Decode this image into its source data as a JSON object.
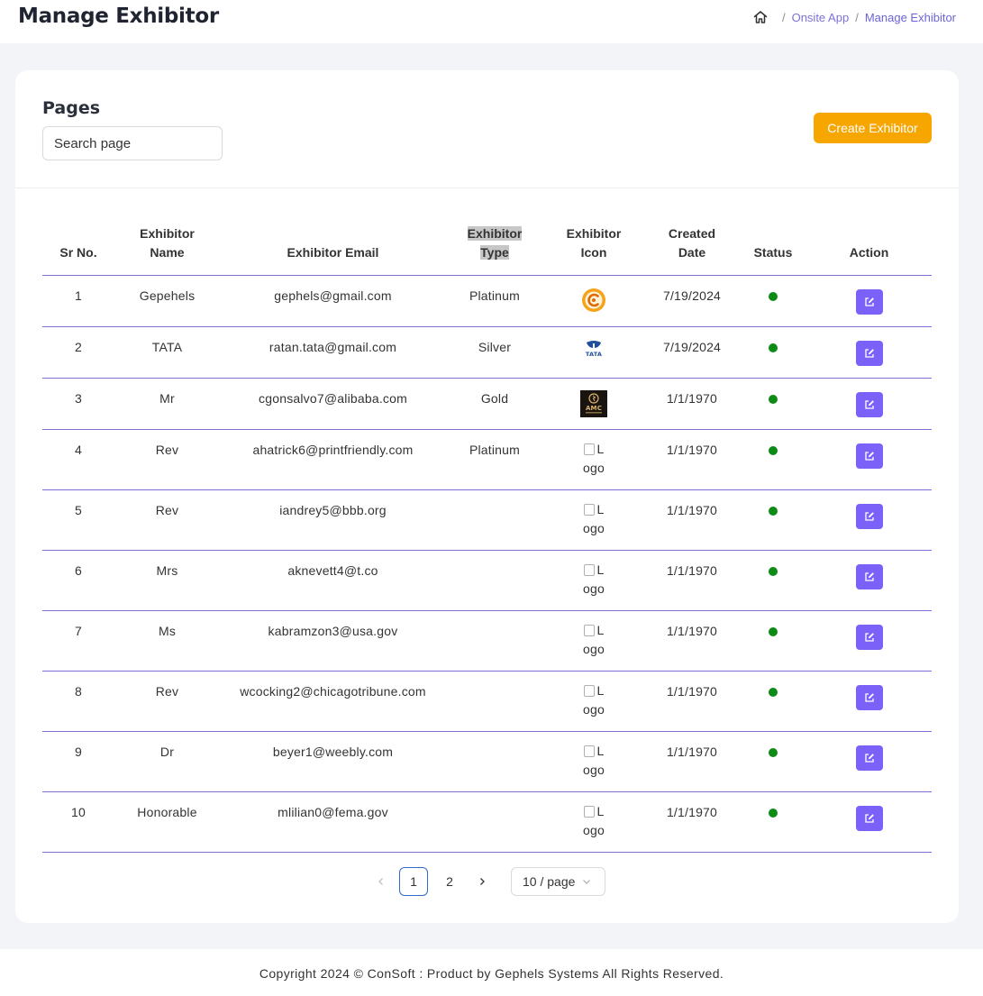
{
  "header": {
    "title": "Manage Exhibitor",
    "breadcrumb": {
      "home_icon": "home-icon",
      "separator": "/",
      "parent": "Onsite App",
      "current": "Manage Exhibitor"
    }
  },
  "card": {
    "title": "Pages",
    "search_placeholder": "Search page",
    "create_button": "Create Exhibitor",
    "accent_color": "#f7a600"
  },
  "table": {
    "headers": {
      "sr": "Sr No.",
      "name_l1": "Exhibitor",
      "name_l2": "Name",
      "email": "Exhibitor Email",
      "type_l1": "Exhibitor",
      "type_l2": "Type",
      "icon_l1": "Exhibitor",
      "icon_l2": "Icon",
      "date_l1": "Created",
      "date_l2": "Date",
      "status": "Status",
      "action": "Action"
    },
    "rows": [
      {
        "sr": "1",
        "name": "Gepehels",
        "email": "gephels@gmail.com",
        "type": "Platinum",
        "icon": "gephels-logo",
        "date": "7/19/2024",
        "status": "active"
      },
      {
        "sr": "2",
        "name": "TATA",
        "email": "ratan.tata@gmail.com",
        "type": "Silver",
        "icon": "tata-logo",
        "icon_text": "TATA",
        "date": "7/19/2024",
        "status": "active"
      },
      {
        "sr": "3",
        "name": "Mr",
        "email": "cgonsalvo7@alibaba.com",
        "type": "Gold",
        "icon": "amc-logo",
        "icon_text": "AMC",
        "date": "1/1/1970",
        "status": "active"
      },
      {
        "sr": "4",
        "name": "Rev",
        "email": "ahatrick6@printfriendly.com",
        "type": "Platinum",
        "icon": "broken-image",
        "alt_l1": "L",
        "alt_l2": "ogo",
        "date": "1/1/1970",
        "status": "active"
      },
      {
        "sr": "5",
        "name": "Rev",
        "email": "iandrey5@bbb.org",
        "type": "",
        "icon": "broken-image",
        "alt_l1": "L",
        "alt_l2": "ogo",
        "date": "1/1/1970",
        "status": "active"
      },
      {
        "sr": "6",
        "name": "Mrs",
        "email": "aknevett4@t.co",
        "type": "",
        "icon": "broken-image",
        "alt_l1": "L",
        "alt_l2": "ogo",
        "date": "1/1/1970",
        "status": "active"
      },
      {
        "sr": "7",
        "name": "Ms",
        "email": "kabramzon3@usa.gov",
        "type": "",
        "icon": "broken-image",
        "alt_l1": "L",
        "alt_l2": "ogo",
        "date": "1/1/1970",
        "status": "active"
      },
      {
        "sr": "8",
        "name": "Rev",
        "email": "wcocking2@chicagotribune.com",
        "type": "",
        "icon": "broken-image",
        "alt_l1": "L",
        "alt_l2": "ogo",
        "date": "1/1/1970",
        "status": "active"
      },
      {
        "sr": "9",
        "name": "Dr",
        "email": "beyer1@weebly.com",
        "type": "",
        "icon": "broken-image",
        "alt_l1": "L",
        "alt_l2": "ogo",
        "date": "1/1/1970",
        "status": "active"
      },
      {
        "sr": "10",
        "name": "Honorable",
        "email": "mlilian0@fema.gov",
        "type": "",
        "icon": "broken-image",
        "alt_l1": "L",
        "alt_l2": "ogo",
        "date": "1/1/1970",
        "status": "active"
      }
    ],
    "status_color": "#0e8a16",
    "edit_button_color": "#7b61f8"
  },
  "pagination": {
    "prev_icon": "chevron-left-icon",
    "next_icon": "chevron-right-icon",
    "pages": [
      "1",
      "2"
    ],
    "current": "1",
    "page_size": "10 / page"
  },
  "footer": {
    "text": "Copyright 2024 © ConSoft : Product by Gephels Systems All Rights Reserved."
  }
}
